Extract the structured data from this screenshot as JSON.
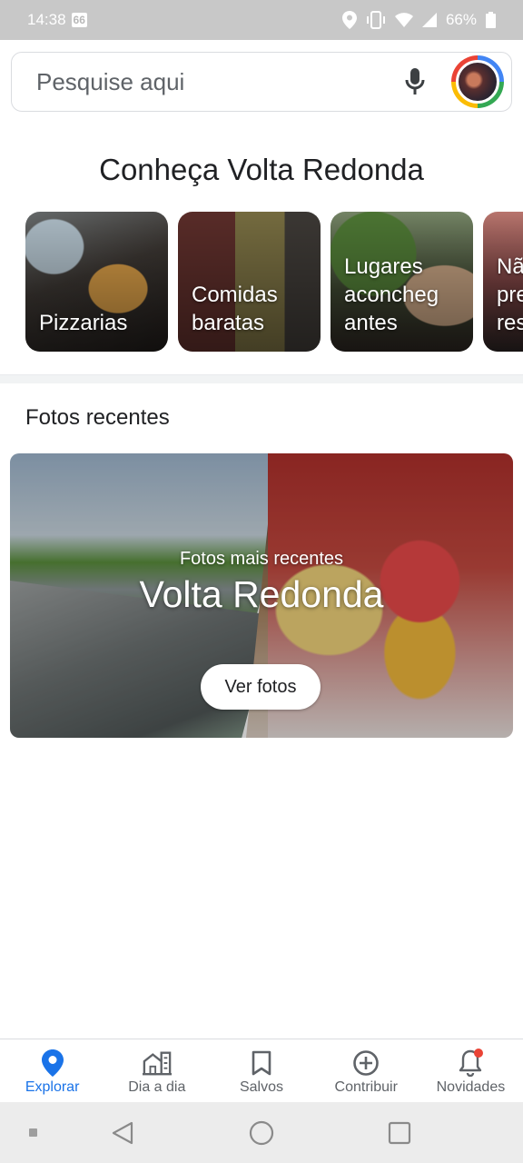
{
  "status": {
    "time": "14:38",
    "notification_count": "66",
    "battery": "66%"
  },
  "search": {
    "placeholder": "Pesquise aqui"
  },
  "explore": {
    "title": "Conheça Volta Redonda",
    "cards": [
      {
        "label": "Pizzarias"
      },
      {
        "label": "Comidas baratas"
      },
      {
        "label": "Lugares aconcheg antes"
      },
      {
        "label": "Nã pre res"
      }
    ]
  },
  "recent_photos": {
    "title": "Fotos recentes",
    "subtitle": "Fotos mais recentes",
    "place": "Volta Redonda",
    "button": "Ver fotos"
  },
  "bottom_nav": [
    {
      "label": "Explorar",
      "icon": "location-pin-icon",
      "active": true
    },
    {
      "label": "Dia a dia",
      "icon": "buildings-icon"
    },
    {
      "label": "Salvos",
      "icon": "bookmark-icon"
    },
    {
      "label": "Contribuir",
      "icon": "add-circle-icon"
    },
    {
      "label": "Novidades",
      "icon": "bell-icon"
    }
  ],
  "colors": {
    "accent": "#1a73e8",
    "badge": "#ea4335"
  }
}
